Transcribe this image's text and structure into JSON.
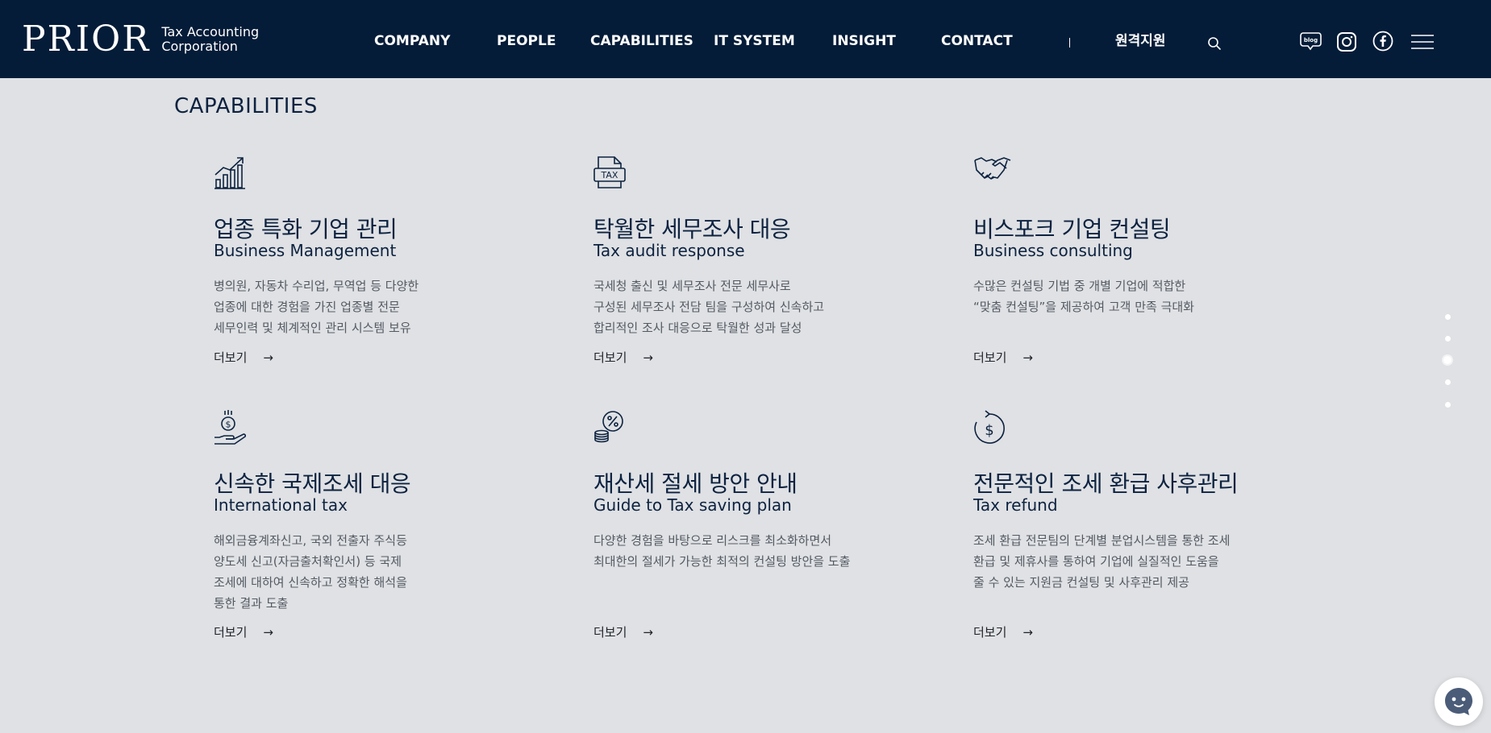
{
  "header": {
    "logo_main": "PRIOR",
    "logo_sub_1": "Tax Accounting",
    "logo_sub_2": "Corporation",
    "nav": [
      "COMPANY",
      "PEOPLE",
      "CAPABILITIES",
      "IT SYSTEM",
      "INSIGHT",
      "CONTACT"
    ],
    "remote_support": "원격지원",
    "icons": [
      "search-icon",
      "blog-icon",
      "instagram-icon",
      "facebook-icon",
      "menu-icon"
    ],
    "blog_label": "blog"
  },
  "section_title": "CAPABILITIES",
  "cards": [
    {
      "icon": "growth-chart-icon",
      "title_ko": "업종 특화 기업 관리",
      "title_en": "Business Management",
      "desc": [
        "병의원, 자동차 수리업, 무역업 등 다양한",
        "업종에 대한 경험을 가진 업종별 전문",
        "세무인력 및 체계적인 관리 시스템 보유"
      ],
      "more": "더보기"
    },
    {
      "icon": "tax-document-icon",
      "title_ko": "탁월한 세무조사 대응",
      "title_en": "Tax audit response",
      "desc": [
        "국세청 출신 및 세무조사 전문 세무사로",
        "구성된 세무조사 전담 팀을 구성하여 신속하고",
        "합리적인 조사 대응으로 탁월한 성과 달성"
      ],
      "more": "더보기",
      "tax_label": "TAX"
    },
    {
      "icon": "handshake-icon",
      "title_ko": "비스포크 기업 컨설팅",
      "title_en": "Business consulting",
      "desc": [
        "수많은 컨설팅 기법 중 개별 기업에 적합한",
        "“맞춤 컨설팅”을 제공하여 고객 만족 극대화"
      ],
      "more": "더보기"
    },
    {
      "icon": "coin-hand-icon",
      "title_ko": "신속한 국제조세 대응",
      "title_en": "International tax",
      "desc": [
        "해외금융계좌신고, 국외 전출자 주식등",
        "양도세 신고(자금출처확인서) 등 국제",
        "조세에 대하여 신속하고 정확한 해석을",
        "통한 결과 도출"
      ],
      "more": "더보기"
    },
    {
      "icon": "percent-coins-icon",
      "title_ko": "재산세 절세 방안 안내",
      "title_en": "Guide to Tax saving plan",
      "desc": [
        "다양한 경험을 바탕으로 리스크를 최소화하면서",
        "최대한의 절세가 가능한 최적의 컨설팅 방안을 도출"
      ],
      "more": "더보기"
    },
    {
      "icon": "dollar-refresh-icon",
      "title_ko": "전문적인 조세 환급 사후관리",
      "title_en": "Tax refund",
      "desc": [
        "조세 환급 전문팀의 단계별 분업시스템을 통한 조세",
        "환급 및 제휴사를 통하여 기업에 실질적인 도움을",
        "줄 수 있는 지원금 컨설팅 및 사후관리 제공"
      ],
      "more": "더보기"
    }
  ],
  "more_arrow": "→",
  "side_nav": {
    "count": 5,
    "active_index": 2
  },
  "chat": {
    "icon": "chatbot-icon"
  }
}
